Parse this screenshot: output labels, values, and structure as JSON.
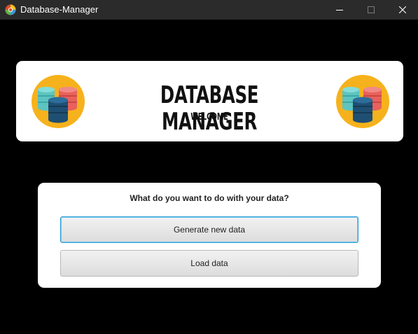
{
  "window": {
    "title": "Database-Manager",
    "icon": "java-coffee-icon",
    "controls": [
      "minimize-icon",
      "maximize-icon",
      "close-icon"
    ]
  },
  "banner": {
    "title": "DATABASE MANAGER",
    "subtitle": "WELCOME",
    "logo_icon": "database-stack-icon",
    "colors": {
      "circle": "#f6b21c",
      "teal": "#5dc4c0",
      "red": "#e8615c",
      "navy": "#1f4f73"
    }
  },
  "panel": {
    "question": "What do you want to do with your data?",
    "buttons": {
      "generate": "Generate new data",
      "load": "Load data"
    }
  }
}
